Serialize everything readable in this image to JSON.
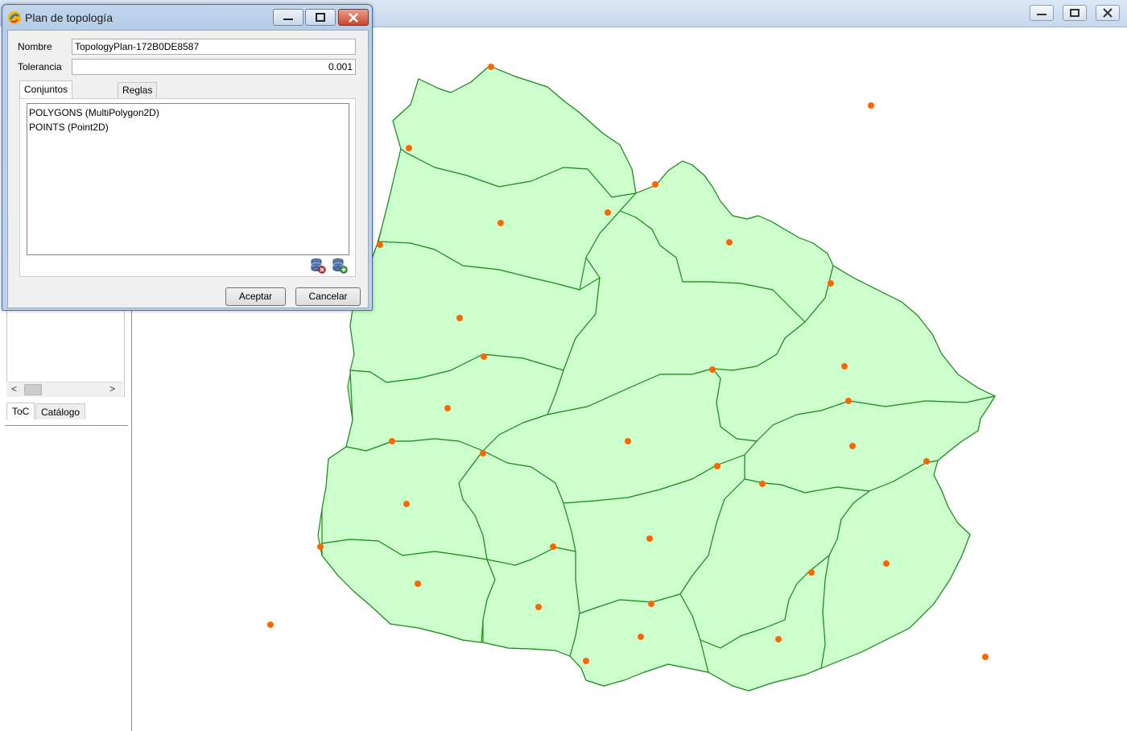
{
  "map_window": {
    "left_panel": {
      "tabs": [
        "ToC",
        "Catálogo"
      ],
      "scroll_left": "<",
      "scroll_right": ">"
    },
    "map": {
      "polygon_fill": "#ccffcc",
      "polygon_stroke": "#1e8c1e",
      "point_color": "#ff6600"
    }
  },
  "dialog": {
    "title": "Plan de topología",
    "nombre_label": "Nombre",
    "nombre_value": "TopologyPlan-172B0DE8587",
    "tolerancia_label": "Tolerancia",
    "tolerancia_value": "0.001",
    "tabs": [
      "Conjuntos de datos",
      "Reglas"
    ],
    "datasets": [
      "POLYGONS (MultiPolygon2D)",
      "POINTS (Point2D)"
    ],
    "remove_dataset_icon": "database-remove-icon",
    "add_dataset_icon": "database-add-icon",
    "accept_label": "Aceptar",
    "cancel_label": "Cancelar"
  }
}
